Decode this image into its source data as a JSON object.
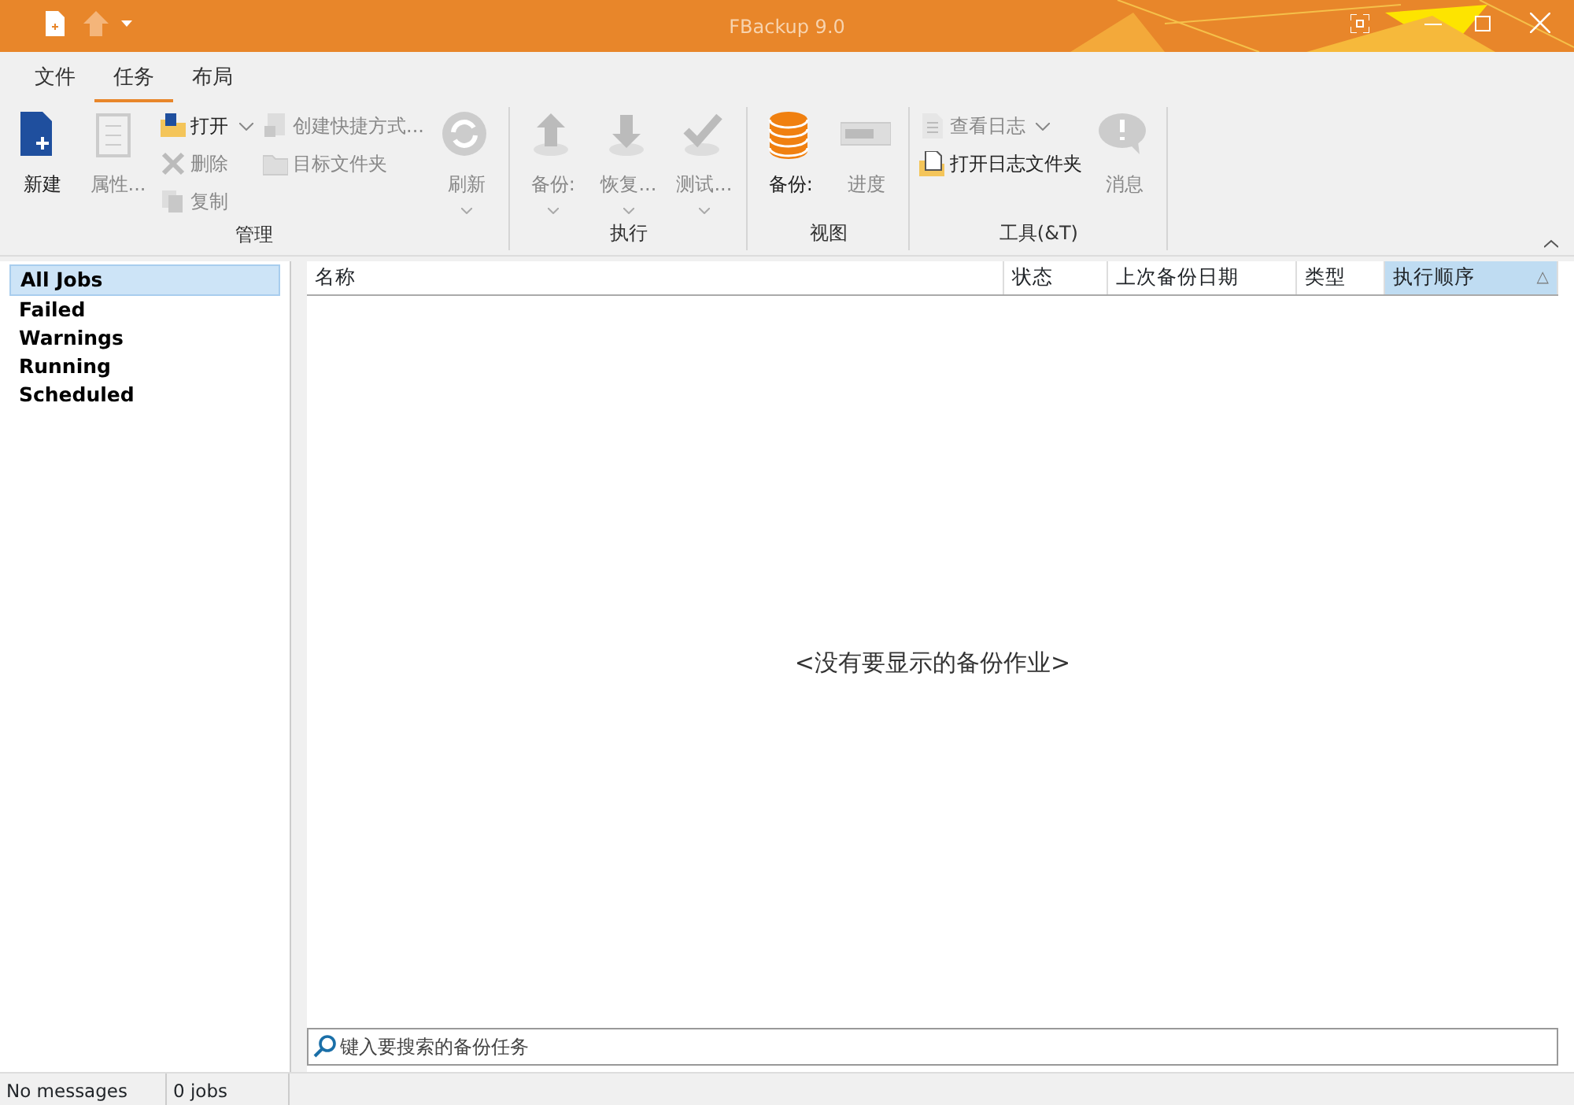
{
  "window": {
    "title": "FBackup 9.0"
  },
  "ribbon_tabs": [
    {
      "label": "文件",
      "selected": false
    },
    {
      "label": "任务",
      "selected": true
    },
    {
      "label": "布局",
      "selected": false
    }
  ],
  "ribbon_groups": [
    {
      "label": "管理",
      "items": [
        {
          "kind": "large",
          "label": "新建",
          "disabled": false,
          "dropdown": false
        },
        {
          "kind": "large",
          "label": "属性...",
          "disabled": true,
          "dropdown": false
        },
        {
          "kind": "column",
          "items": [
            {
              "label": "打开",
              "disabled": false,
              "dropdown": true
            },
            {
              "label": "删除",
              "disabled": true,
              "dropdown": false
            },
            {
              "label": "复制",
              "disabled": true,
              "dropdown": false
            }
          ]
        },
        {
          "kind": "column",
          "items": [
            {
              "label": "创建快捷方式...",
              "disabled": true,
              "dropdown": false
            },
            {
              "label": "目标文件夹",
              "disabled": true,
              "dropdown": false
            }
          ]
        },
        {
          "kind": "large",
          "label": "刷新",
          "disabled": true,
          "dropdown": true
        }
      ]
    },
    {
      "label": "执行",
      "items": [
        {
          "kind": "large",
          "label": "备份:",
          "disabled": true,
          "dropdown": true
        },
        {
          "kind": "large",
          "label": "恢复...",
          "disabled": true,
          "dropdown": true
        },
        {
          "kind": "large",
          "label": "测试...",
          "disabled": true,
          "dropdown": true
        }
      ]
    },
    {
      "label": "视图",
      "items": [
        {
          "kind": "large",
          "label": "备份:",
          "disabled": false,
          "dropdown": false
        },
        {
          "kind": "large",
          "label": "进度",
          "disabled": true,
          "dropdown": false
        }
      ]
    },
    {
      "label": "工具(&T)",
      "items": [
        {
          "kind": "column",
          "items": [
            {
              "label": "查看日志",
              "disabled": true,
              "dropdown": true
            },
            {
              "label": "打开日志文件夹",
              "disabled": false,
              "dropdown": false
            }
          ]
        },
        {
          "kind": "large",
          "label": "消息",
          "disabled": true,
          "dropdown": false
        }
      ]
    }
  ],
  "sidebar": {
    "items": [
      {
        "label": "All Jobs",
        "selected": true
      },
      {
        "label": "Failed",
        "selected": false
      },
      {
        "label": "Warnings",
        "selected": false
      },
      {
        "label": "Running",
        "selected": false
      },
      {
        "label": "Scheduled",
        "selected": false
      }
    ]
  },
  "table": {
    "columns": [
      {
        "label": "名称",
        "sorted": false
      },
      {
        "label": "状态",
        "sorted": false
      },
      {
        "label": "上次备份日期",
        "sorted": false
      },
      {
        "label": "类型",
        "sorted": false
      },
      {
        "label": "执行顺序",
        "sorted": true,
        "sort_arrow": "△"
      }
    ],
    "empty_message": "<没有要显示的备份作业>"
  },
  "search": {
    "placeholder": "键入要搜索的备份任务"
  },
  "status_bar": [
    "No messages",
    "0 jobs"
  ]
}
